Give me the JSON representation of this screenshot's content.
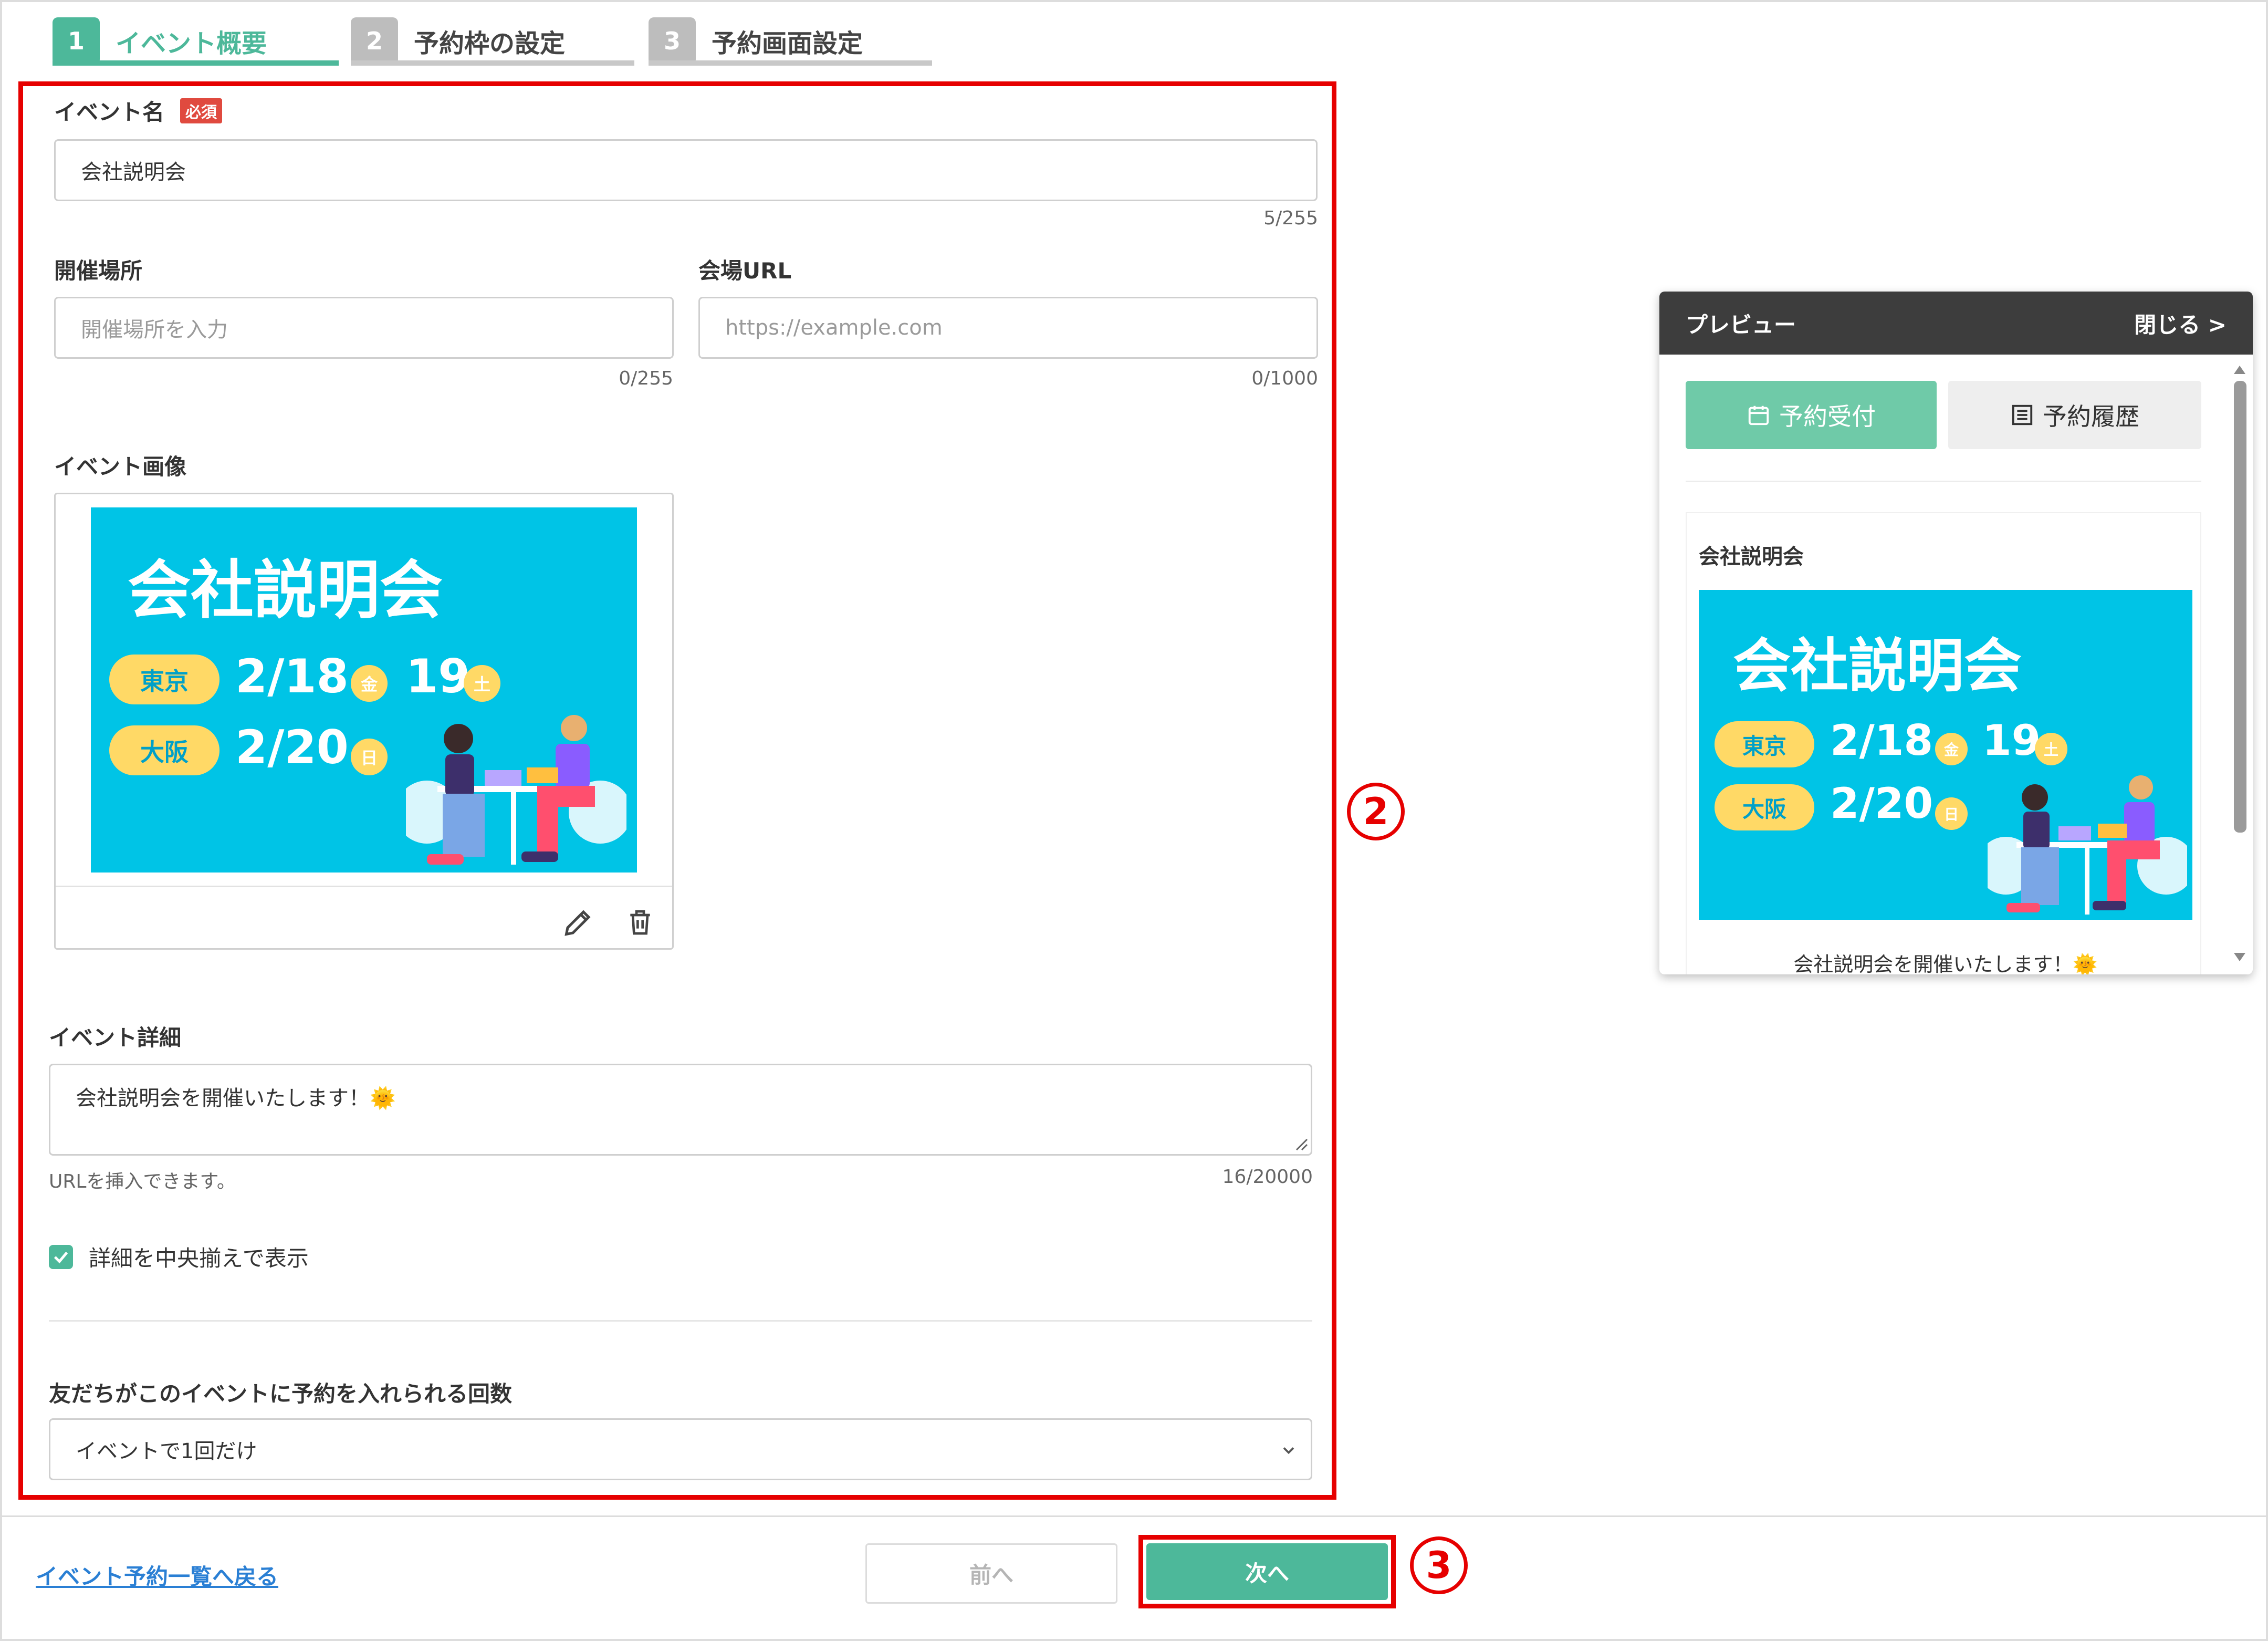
{
  "steps": [
    {
      "num": "1",
      "label": "イベント概要",
      "active": true
    },
    {
      "num": "2",
      "label": "予約枠の設定",
      "active": false
    },
    {
      "num": "3",
      "label": "予約画面設定",
      "active": false
    }
  ],
  "form": {
    "event_name": {
      "label": "イベント名",
      "required": "必須",
      "value": "会社説明会",
      "counter": "5/255"
    },
    "venue": {
      "label": "開催場所",
      "placeholder": "開催場所を入力",
      "counter": "0/255"
    },
    "venue_url": {
      "label": "会場URL",
      "placeholder": "https://example.com",
      "counter": "0/1000"
    },
    "image": {
      "label": "イベント画像"
    },
    "details": {
      "label": "イベント詳細",
      "value": "会社説明会を開催いたします！🌞",
      "hint": "URLを挿入できます。",
      "counter": "16/20000"
    },
    "center_checkbox": {
      "label": "詳細を中央揃えで表示",
      "checked": true
    },
    "booking_limit": {
      "label": "友だちがこのイベントに予約を入れられる回数",
      "value": "イベントで1回だけ"
    }
  },
  "promo": {
    "title": "会社説明会",
    "tokyo": "東京",
    "osaka": "大阪",
    "tokyo_date1": "2/18",
    "tokyo_day1": "金",
    "tokyo_date2": "19",
    "tokyo_day2": "土",
    "osaka_date": "2/20",
    "osaka_day": "日"
  },
  "annotations": {
    "two": "2",
    "three": "3"
  },
  "footer": {
    "back_link": "イベント予約一覧へ戻る",
    "prev_button": "前へ",
    "next_button": "次へ"
  },
  "preview": {
    "header": "プレビュー",
    "close": "閉じる >",
    "tab_reserve": "予約受付",
    "tab_history": "予約履歴",
    "event_title": "会社説明会",
    "desc": "会社説明会を開催いたします！🌞"
  },
  "colors": {
    "accent": "#4db89a",
    "annotation": "#e60000",
    "promo_bg": "#00c4e6"
  }
}
